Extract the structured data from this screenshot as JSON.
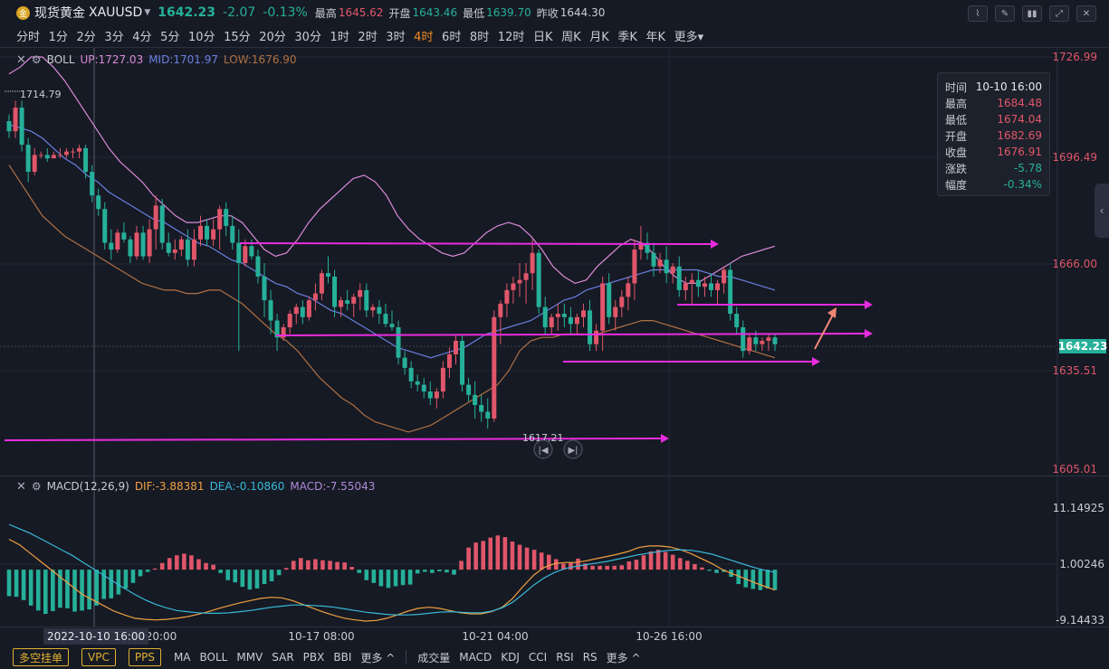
{
  "header": {
    "logo_text": "金",
    "symbol_name": "现货黄金",
    "symbol_code": "XAUUSD",
    "last_price": "1642.23",
    "change": "-2.07",
    "change_pct": "-0.13%",
    "quotes": [
      {
        "label": "最高",
        "value": "1645.62",
        "color": "red"
      },
      {
        "label": "开盘",
        "value": "1643.46",
        "color": "green"
      },
      {
        "label": "最低",
        "value": "1639.70",
        "color": "green"
      },
      {
        "label": "昨收",
        "value": "1644.30",
        "color": "gray"
      }
    ]
  },
  "timeframes": [
    "分时",
    "1分",
    "2分",
    "3分",
    "4分",
    "5分",
    "10分",
    "15分",
    "20分",
    "30分",
    "1时",
    "2时",
    "3时",
    "4时",
    "6时",
    "8时",
    "12时",
    "日K",
    "周K",
    "月K",
    "季K",
    "年K",
    "更多▾"
  ],
  "active_timeframe": "4时",
  "boll": {
    "name": "BOLL",
    "up": "UP:1727.03",
    "mid": "MID:1701.97",
    "low": "LOW:1676.90"
  },
  "macd_head": {
    "name": "MACD(12,26,9)",
    "dif": "DIF:-3.88381",
    "dea": "DEA:-0.10860",
    "macd": "MACD:-7.55043"
  },
  "info_box": [
    {
      "k": "时间",
      "v": "10-10 16:00",
      "c": "#e6e8ee"
    },
    {
      "k": "最高",
      "v": "1684.48",
      "c": "#e0566a"
    },
    {
      "k": "最低",
      "v": "1674.04",
      "c": "#e0566a"
    },
    {
      "k": "开盘",
      "v": "1682.69",
      "c": "#e0566a"
    },
    {
      "k": "收盘",
      "v": "1676.91",
      "c": "#e0566a"
    },
    {
      "k": "涨跌",
      "v": "-5.78",
      "c": "#26b09a"
    },
    {
      "k": "幅度",
      "v": "-0.34%",
      "c": "#26b09a"
    }
  ],
  "bottom": {
    "buttons": [
      "多空挂单",
      "VPC",
      "PPS"
    ],
    "main_indicators": [
      "MA",
      "BOLL",
      "MMV",
      "SAR",
      "PBX",
      "BBI",
      "更多 ^"
    ],
    "sub_indicators": [
      "成交量",
      "MACD",
      "KDJ",
      "CCI",
      "RSI",
      "RS",
      "更多 ^"
    ]
  },
  "time_tip": "2022-10-10 16:00",
  "colors": {
    "up": "#e0566a",
    "down": "#26b09a",
    "boll_up": "#d98ad8",
    "boll_mid": "#6b7fe0",
    "boll_low": "#b07044",
    "annot": "#ea2ce0",
    "dif": "#f0a040",
    "dea": "#39b8d8",
    "arrow": "#f08878"
  },
  "chart_data": [
    {
      "type": "candlestick",
      "title": "现货黄金 XAUUSD 4时",
      "y_ticks": [
        "1726.99",
        "1696.49",
        "1666.00",
        "1635.51",
        "1605.01"
      ],
      "current_price_label": "1642.23",
      "x_ticks": [
        "20:00",
        "10-17 08:00",
        "10-21 04:00",
        "10-26 16:00"
      ],
      "annotations": {
        "high_label": "1714.79",
        "low_label": "1617.21"
      },
      "candles": [
        [
          1708,
          1710,
          1703,
          1705
        ],
        [
          1705,
          1714,
          1703,
          1712
        ],
        [
          1712,
          1714,
          1699,
          1701
        ],
        [
          1701,
          1703,
          1690,
          1693
        ],
        [
          1693,
          1700,
          1692,
          1698
        ],
        [
          1698,
          1699,
          1697,
          1698
        ],
        [
          1698,
          1700,
          1696,
          1697
        ],
        [
          1697,
          1699,
          1697,
          1698
        ],
        [
          1698,
          1700,
          1697,
          1698
        ],
        [
          1698,
          1700,
          1697,
          1699
        ],
        [
          1699,
          1700,
          1697,
          1699
        ],
        [
          1699,
          1701,
          1697,
          1700
        ],
        [
          1700,
          1701,
          1691,
          1693
        ],
        [
          1693,
          1695,
          1684,
          1686
        ],
        [
          1686,
          1688,
          1680,
          1682
        ],
        [
          1682,
          1684,
          1670,
          1672
        ],
        [
          1672,
          1676,
          1667,
          1670
        ],
        [
          1670,
          1676,
          1669,
          1675
        ],
        [
          1675,
          1678,
          1672,
          1673
        ],
        [
          1673,
          1674,
          1666,
          1668
        ],
        [
          1668,
          1677,
          1667,
          1675
        ],
        [
          1675,
          1677,
          1667,
          1668
        ],
        [
          1668,
          1679,
          1666,
          1676
        ],
        [
          1676,
          1686,
          1670,
          1683
        ],
        [
          1683,
          1685,
          1670,
          1672
        ],
        [
          1672,
          1675,
          1668,
          1669
        ],
        [
          1669,
          1673,
          1667,
          1670
        ],
        [
          1670,
          1674,
          1668,
          1673
        ],
        [
          1673,
          1676,
          1665,
          1667
        ],
        [
          1667,
          1676,
          1665,
          1673
        ],
        [
          1673,
          1680,
          1671,
          1677
        ],
        [
          1677,
          1679,
          1671,
          1673
        ],
        [
          1673,
          1679,
          1671,
          1676
        ],
        [
          1676,
          1683,
          1670,
          1682
        ],
        [
          1682,
          1684,
          1674,
          1677
        ],
        [
          1677,
          1680,
          1670,
          1672
        ],
        [
          1672,
          1676,
          1640,
          1666
        ],
        [
          1666,
          1673,
          1665,
          1671
        ],
        [
          1671,
          1673,
          1667,
          1668
        ],
        [
          1668,
          1670,
          1660,
          1662
        ],
        [
          1662,
          1666,
          1650,
          1655
        ],
        [
          1655,
          1658,
          1645,
          1649
        ],
        [
          1649,
          1651,
          1640,
          1644
        ],
        [
          1644,
          1648,
          1643,
          1647
        ],
        [
          1647,
          1652,
          1645,
          1651
        ],
        [
          1651,
          1654,
          1648,
          1653
        ],
        [
          1653,
          1655,
          1648,
          1650
        ],
        [
          1650,
          1656,
          1649,
          1655
        ],
        [
          1655,
          1660,
          1652,
          1657
        ],
        [
          1657,
          1664,
          1655,
          1663
        ],
        [
          1663,
          1668,
          1660,
          1662
        ],
        [
          1662,
          1664,
          1650,
          1653
        ],
        [
          1653,
          1656,
          1650,
          1655
        ],
        [
          1655,
          1658,
          1652,
          1654
        ],
        [
          1654,
          1657,
          1650,
          1656
        ],
        [
          1656,
          1660,
          1652,
          1658
        ],
        [
          1658,
          1660,
          1650,
          1652
        ],
        [
          1652,
          1654,
          1650,
          1653
        ],
        [
          1653,
          1655,
          1648,
          1651
        ],
        [
          1651,
          1654,
          1647,
          1648
        ],
        [
          1648,
          1652,
          1646,
          1647
        ],
        [
          1647,
          1649,
          1636,
          1638
        ],
        [
          1638,
          1640,
          1633,
          1635
        ],
        [
          1635,
          1637,
          1629,
          1631
        ],
        [
          1631,
          1633,
          1628,
          1630
        ],
        [
          1630,
          1632,
          1626,
          1628
        ],
        [
          1628,
          1631,
          1624,
          1626
        ],
        [
          1626,
          1629,
          1623,
          1628
        ],
        [
          1628,
          1637,
          1626,
          1635
        ],
        [
          1635,
          1641,
          1632,
          1639
        ],
        [
          1639,
          1645,
          1636,
          1643
        ],
        [
          1643,
          1645,
          1628,
          1630
        ],
        [
          1630,
          1632,
          1625,
          1627
        ],
        [
          1627,
          1631,
          1620,
          1624
        ],
        [
          1624,
          1627,
          1619,
          1622
        ],
        [
          1622,
          1626,
          1617,
          1620
        ],
        [
          1620,
          1652,
          1619,
          1650
        ],
        [
          1650,
          1655,
          1642,
          1654
        ],
        [
          1654,
          1660,
          1650,
          1658
        ],
        [
          1658,
          1662,
          1654,
          1660
        ],
        [
          1660,
          1666,
          1656,
          1661
        ],
        [
          1661,
          1666,
          1654,
          1663
        ],
        [
          1663,
          1673,
          1658,
          1669
        ],
        [
          1669,
          1670,
          1651,
          1653
        ],
        [
          1653,
          1656,
          1645,
          1647
        ],
        [
          1647,
          1651,
          1645,
          1650
        ],
        [
          1650,
          1654,
          1646,
          1651
        ],
        [
          1651,
          1654,
          1647,
          1650
        ],
        [
          1650,
          1653,
          1645,
          1648
        ],
        [
          1648,
          1651,
          1645,
          1650
        ],
        [
          1650,
          1654,
          1647,
          1652
        ],
        [
          1652,
          1655,
          1640,
          1642
        ],
        [
          1642,
          1648,
          1640,
          1646
        ],
        [
          1646,
          1662,
          1640,
          1660
        ],
        [
          1660,
          1663,
          1648,
          1650
        ],
        [
          1650,
          1655,
          1646,
          1653
        ],
        [
          1653,
          1658,
          1650,
          1656
        ],
        [
          1656,
          1662,
          1652,
          1660
        ],
        [
          1660,
          1673,
          1655,
          1670
        ],
        [
          1670,
          1677,
          1667,
          1672
        ],
        [
          1672,
          1675,
          1667,
          1669
        ],
        [
          1669,
          1672,
          1662,
          1665
        ],
        [
          1665,
          1669,
          1663,
          1667
        ],
        [
          1667,
          1671,
          1660,
          1663
        ],
        [
          1663,
          1666,
          1660,
          1665
        ],
        [
          1665,
          1668,
          1656,
          1658
        ],
        [
          1658,
          1662,
          1655,
          1660
        ],
        [
          1660,
          1663,
          1654,
          1661
        ],
        [
          1661,
          1664,
          1656,
          1659
        ],
        [
          1659,
          1662,
          1656,
          1660
        ],
        [
          1660,
          1663,
          1656,
          1658
        ],
        [
          1658,
          1661,
          1654,
          1660
        ],
        [
          1660,
          1665,
          1657,
          1664
        ],
        [
          1664,
          1666,
          1649,
          1651
        ],
        [
          1651,
          1653,
          1645,
          1647
        ],
        [
          1647,
          1649,
          1638,
          1640
        ],
        [
          1640,
          1645,
          1639,
          1644
        ],
        [
          1644,
          1646,
          1640,
          1642
        ],
        [
          1642,
          1644,
          1640,
          1643
        ],
        [
          1643,
          1645,
          1640,
          1644
        ],
        [
          1644,
          1645,
          1640,
          1642
        ]
      ],
      "boll_up": [
        1722,
        1724,
        1727,
        1727,
        1724,
        1720,
        1715,
        1710,
        1705,
        1700,
        1696,
        1693,
        1690,
        1686,
        1683,
        1680,
        1678,
        1678,
        1679,
        1680,
        1680,
        1678,
        1674,
        1670,
        1668,
        1669,
        1673,
        1678,
        1682,
        1685,
        1688,
        1691,
        1692,
        1690,
        1686,
        1680,
        1676,
        1673,
        1671,
        1669,
        1668,
        1669,
        1672,
        1675,
        1677,
        1678,
        1677,
        1674,
        1670,
        1665,
        1662,
        1660,
        1661,
        1665,
        1668,
        1671,
        1673,
        1672,
        1669,
        1665,
        1662,
        1660,
        1660,
        1662,
        1664,
        1666,
        1668,
        1669,
        1670,
        1671
      ],
      "boll_mid": [
        1707,
        1706,
        1705,
        1703,
        1700,
        1697,
        1695,
        1692,
        1690,
        1687,
        1685,
        1683,
        1681,
        1679,
        1678,
        1676,
        1674,
        1672,
        1671,
        1669,
        1667,
        1666,
        1664,
        1662,
        1660,
        1659,
        1657,
        1656,
        1654,
        1652,
        1651,
        1649,
        1647,
        1645,
        1643,
        1641,
        1640,
        1639,
        1638,
        1639,
        1640,
        1641,
        1643,
        1645,
        1646,
        1647,
        1648,
        1649,
        1651,
        1653,
        1655,
        1656,
        1658,
        1659,
        1660,
        1661,
        1662,
        1663,
        1664,
        1664,
        1664,
        1664,
        1664,
        1663,
        1662,
        1662,
        1661,
        1660,
        1659,
        1658
      ],
      "boll_low": [
        1695,
        1690,
        1685,
        1680,
        1677,
        1674,
        1672,
        1670,
        1668,
        1666,
        1664,
        1662,
        1660,
        1659,
        1658,
        1658,
        1657,
        1657,
        1658,
        1658,
        1656,
        1654,
        1651,
        1648,
        1645,
        1643,
        1640,
        1636,
        1632,
        1629,
        1626,
        1624,
        1621,
        1619,
        1618,
        1617,
        1616,
        1617,
        1618,
        1620,
        1622,
        1624,
        1626,
        1628,
        1630,
        1634,
        1640,
        1643,
        1644,
        1644,
        1645,
        1645,
        1645,
        1645,
        1646,
        1647,
        1648,
        1649,
        1649,
        1648,
        1647,
        1646,
        1645,
        1644,
        1643,
        1642,
        1641,
        1640,
        1639,
        1638
      ]
    },
    {
      "type": "bar",
      "title": "MACD(12,26,9)",
      "y_ticks": [
        "11.14925",
        "1.00246",
        "-9.14433"
      ],
      "histogram": [
        -4.8,
        -4.9,
        -5.5,
        -6.5,
        -7.4,
        -8.0,
        -7.5,
        -6.9,
        -7.0,
        -7.6,
        -7.4,
        -7.2,
        -6.5,
        -5.3,
        -5.2,
        -4.5,
        -3.4,
        -2.4,
        -1.2,
        -0.4,
        0.2,
        1.2,
        2.1,
        2.6,
        2.9,
        2.6,
        1.9,
        1.2,
        0.9,
        -0.6,
        -1.9,
        -2.3,
        -3.1,
        -3.6,
        -3.4,
        -2.6,
        -2.1,
        -1.0,
        0.3,
        1.6,
        2.1,
        1.7,
        1.9,
        1.7,
        1.6,
        1.4,
        1.3,
        0.5,
        -0.6,
        -1.9,
        -2.4,
        -3.0,
        -3.3,
        -3.0,
        -2.8,
        -2.7,
        -0.7,
        -0.4,
        -0.6,
        -0.3,
        -0.5,
        -0.9,
        1.6,
        4.0,
        4.9,
        5.2,
        5.8,
        6.2,
        5.9,
        5.1,
        4.5,
        4.0,
        3.6,
        3.1,
        2.7,
        1.9,
        1.1,
        1.3,
        2.0,
        1.1,
        0.7,
        0.7,
        0.7,
        0.7,
        0.8,
        1.5,
        1.8,
        2.6,
        3.3,
        3.6,
        3.2,
        2.7,
        2.1,
        1.6,
        1.0,
        0.4,
        -0.2,
        -0.6,
        -0.4,
        -1.3,
        -2.6,
        -3.2,
        -3.5,
        -3.7,
        -3.4,
        -3.7
      ],
      "dif": [
        5.5,
        4.5,
        3.0,
        1.5,
        0.0,
        -1.5,
        -3.0,
        -4.5,
        -5.5,
        -6.5,
        -7.5,
        -8.2,
        -8.8,
        -9.0,
        -9.1,
        -9.0,
        -8.8,
        -8.5,
        -8.1,
        -7.6,
        -7.0,
        -6.5,
        -6.0,
        -5.6,
        -5.2,
        -5.0,
        -5.1,
        -5.6,
        -6.3,
        -7.0,
        -7.7,
        -8.3,
        -8.8,
        -9.1,
        -9.3,
        -9.2,
        -8.8,
        -8.2,
        -7.5,
        -7.0,
        -6.8,
        -7.0,
        -7.4,
        -7.8,
        -8.0,
        -8.0,
        -7.6,
        -6.8,
        -5.2,
        -3.0,
        -1.0,
        0.4,
        1.1,
        1.3,
        1.3,
        1.6,
        2.0,
        2.4,
        2.8,
        3.3,
        4.0,
        4.3,
        4.3,
        4.1,
        3.6,
        2.9,
        2.0,
        1.1,
        0.0,
        -0.8,
        -1.5,
        -2.3,
        -3.0,
        -3.7
      ],
      "dea": [
        8.2,
        7.4,
        6.6,
        5.6,
        4.6,
        3.6,
        2.6,
        1.4,
        0.2,
        -1.0,
        -2.2,
        -3.4,
        -4.5,
        -5.5,
        -6.3,
        -6.9,
        -7.4,
        -7.6,
        -7.8,
        -7.9,
        -7.9,
        -7.8,
        -7.6,
        -7.4,
        -7.1,
        -6.8,
        -6.6,
        -6.4,
        -6.4,
        -6.5,
        -6.6,
        -6.8,
        -7.1,
        -7.4,
        -7.7,
        -7.9,
        -8.1,
        -8.2,
        -8.2,
        -8.1,
        -7.9,
        -7.7,
        -7.6,
        -7.7,
        -7.8,
        -7.8,
        -7.5,
        -6.9,
        -5.9,
        -4.4,
        -2.8,
        -1.5,
        -0.5,
        0.2,
        0.6,
        0.9,
        1.2,
        1.5,
        1.9,
        2.3,
        2.7,
        3.0,
        3.3,
        3.5,
        3.6,
        3.5,
        3.2,
        2.8,
        2.2,
        1.6,
        1.0,
        0.4,
        -0.1,
        -0.5
      ]
    }
  ]
}
